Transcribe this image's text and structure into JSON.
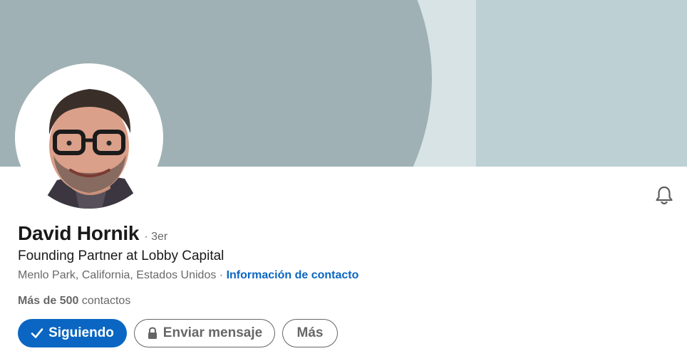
{
  "profile": {
    "name": "David Hornik",
    "degree": "· 3er",
    "headline": "Founding Partner at Lobby Capital",
    "location": "Menlo Park, California, Estados Unidos",
    "location_separator": " · ",
    "contact_info_label": "Información de contacto",
    "connections_count": "Más de 500",
    "connections_label": " contactos"
  },
  "actions": {
    "following_label": "Siguiendo",
    "message_label": "Enviar mensaje",
    "more_label": "Más"
  },
  "icons": {
    "bell": "bell-icon",
    "check": "check-icon",
    "lock": "lock-icon"
  },
  "colors": {
    "primary": "#0a66c2",
    "cover_dark": "#9fb1b4",
    "cover_light": "#bdd0d3"
  }
}
